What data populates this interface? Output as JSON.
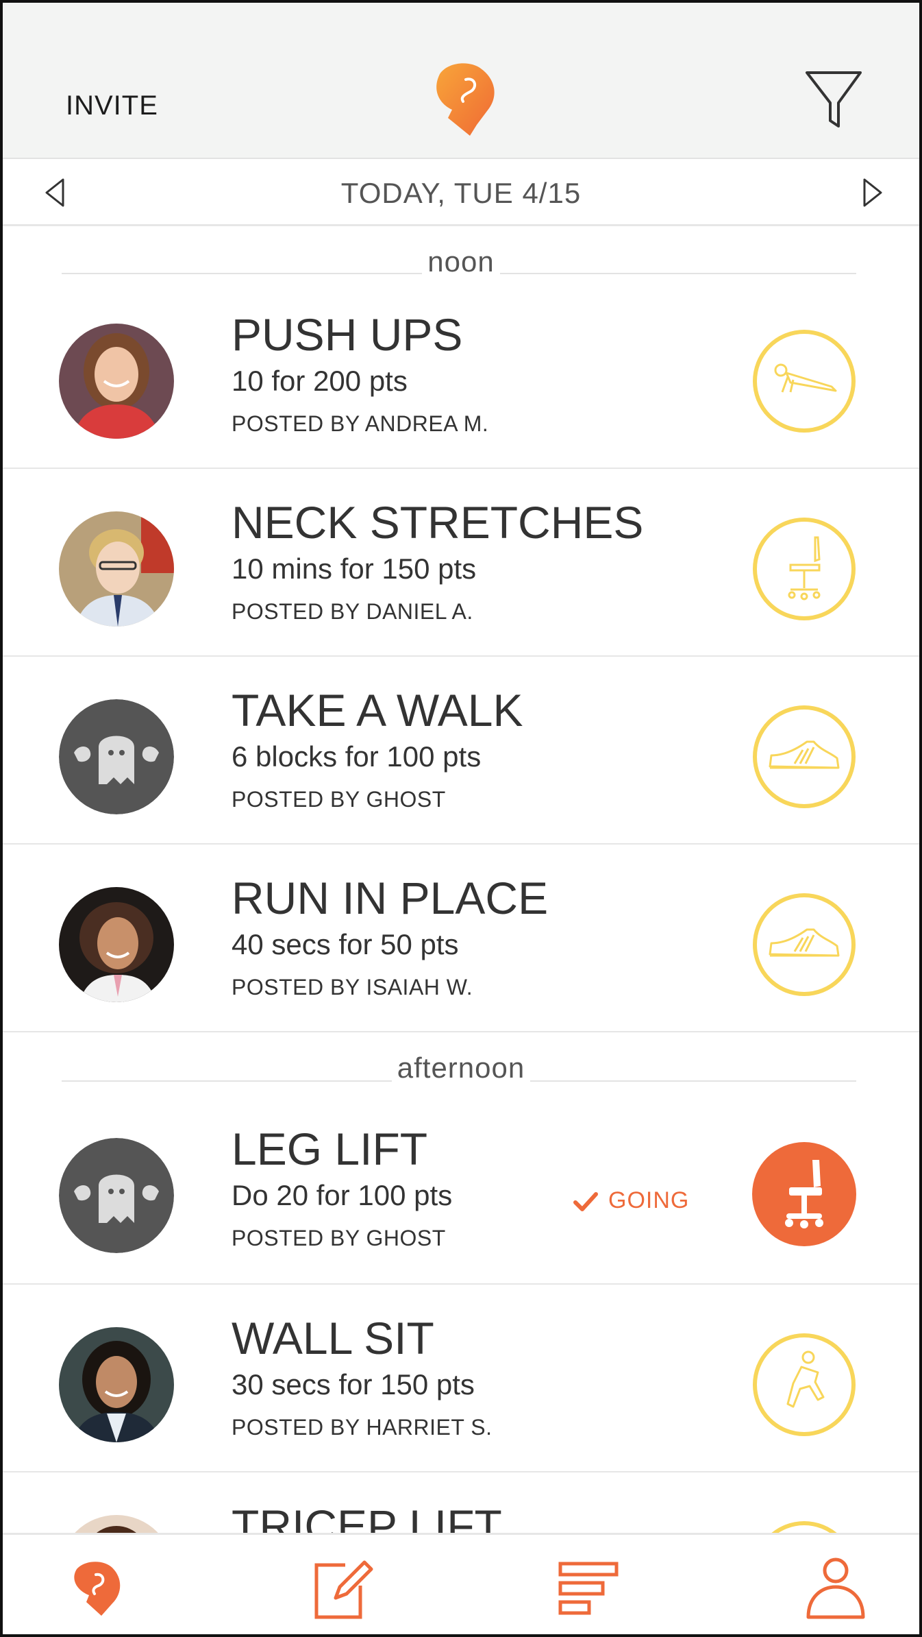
{
  "header": {
    "invite_label": "INVITE",
    "logo_icon": "boxing-glove-icon",
    "filter_icon": "filter-funnel-icon"
  },
  "date_nav": {
    "label": "TODAY, TUE 4/15",
    "prev_icon": "triangle-left-icon",
    "next_icon": "triangle-right-icon"
  },
  "colors": {
    "accent": "#ee6a3a",
    "activity_ring": "#f8d65a",
    "ghost_bg": "#555555",
    "header_bg": "#f3f4f3"
  },
  "sections": [
    {
      "label": "noon",
      "items": [
        {
          "title": "PUSH UPS",
          "detail": "10 for 200 pts",
          "poster": "POSTED BY ANDREA M.",
          "icon": "push-up-icon",
          "avatar": "photo-andrea"
        },
        {
          "title": "NECK STRETCHES",
          "detail": "10 mins for 150 pts",
          "poster": "POSTED BY DANIEL A.",
          "icon": "office-chair-icon",
          "avatar": "photo-daniel"
        },
        {
          "title": "TAKE A WALK",
          "detail": "6 blocks for 100 pts",
          "poster": "POSTED BY GHOST",
          "icon": "sneaker-icon",
          "avatar": "ghost"
        },
        {
          "title": "RUN IN PLACE",
          "detail": "40 secs for 50 pts",
          "poster": "POSTED BY ISAIAH W.",
          "icon": "sneaker-icon",
          "avatar": "photo-isaiah"
        }
      ]
    },
    {
      "label": "afternoon",
      "items": [
        {
          "title": "LEG LIFT",
          "detail": "Do 20 for 100 pts",
          "poster": "POSTED BY GHOST",
          "icon": "office-chair-icon",
          "avatar": "ghost",
          "status": "GOING"
        },
        {
          "title": "WALL SIT",
          "detail": "30 secs for 150 pts",
          "poster": "POSTED BY HARRIET S.",
          "icon": "wall-sit-icon",
          "avatar": "photo-harriet"
        },
        {
          "title": "TRICEP LIFT",
          "detail": "",
          "poster": "",
          "icon": "office-chair-icon",
          "avatar": "photo-partial"
        }
      ]
    }
  ],
  "tabbar": {
    "tabs": [
      "boxing-glove-icon",
      "compose-icon",
      "list-bars-icon",
      "profile-icon"
    ]
  }
}
